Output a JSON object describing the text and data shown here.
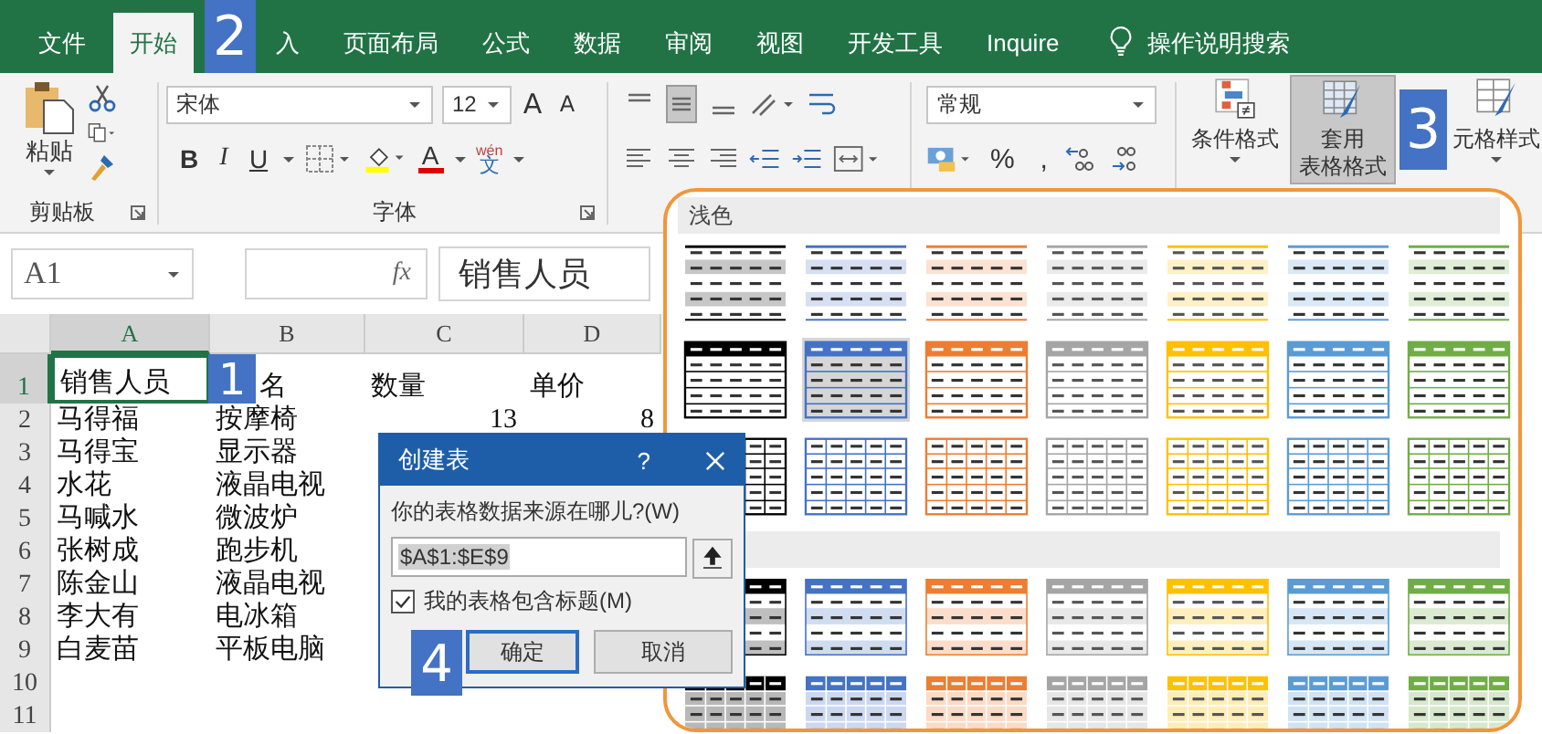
{
  "tabs": [
    {
      "label": "文件",
      "selected": false
    },
    {
      "label": "开始",
      "selected": true
    },
    {
      "label": "入",
      "selected": false,
      "badge": "2"
    },
    {
      "label": "页面布局",
      "selected": false
    },
    {
      "label": "公式",
      "selected": false
    },
    {
      "label": "数据",
      "selected": false
    },
    {
      "label": "审阅",
      "selected": false
    },
    {
      "label": "视图",
      "selected": false
    },
    {
      "label": "开发工具",
      "selected": false
    },
    {
      "label": "Inquire",
      "selected": false
    }
  ],
  "tell_me": "操作说明搜索",
  "ribbon": {
    "clipboard": {
      "paste": "粘贴",
      "label": "剪贴板"
    },
    "font": {
      "name": "宋体",
      "size": "12",
      "grow": "A",
      "shrink": "A",
      "bold": "B",
      "italic": "I",
      "underline": "U",
      "color_letter": "A",
      "phonetic_top": "wén",
      "phonetic": "文",
      "label": "字体"
    },
    "number": {
      "format": "常规",
      "percent": "%",
      "comma": ","
    },
    "styles": {
      "conditional": "条件格式",
      "table_line1": "套用",
      "table_line2": "表格格式",
      "table_selected": true,
      "badge": "3",
      "cell": "元格样式"
    }
  },
  "formula_bar": {
    "name_box": "A1",
    "fx": "fx",
    "content": "销售人员"
  },
  "sheet": {
    "columns": [
      "A",
      "B",
      "C",
      "D"
    ],
    "rows": [
      {
        "header": "1",
        "cells": [
          {
            "text": "销售人员",
            "selected": true
          },
          {
            "text": "名",
            "selected": false,
            "badge": "1"
          },
          {
            "text": "数量",
            "selected": false
          },
          {
            "text": "单价",
            "selected": false
          }
        ]
      },
      {
        "header": "2",
        "cells": [
          {
            "text": "马得福",
            "selected": false
          },
          {
            "text": "按摩椅",
            "selected": false
          },
          {
            "text": "13",
            "selected": false
          },
          {
            "text": "8",
            "selected": false
          }
        ]
      },
      {
        "header": "3",
        "cells": [
          {
            "text": "马得宝",
            "selected": false
          },
          {
            "text": "显示器",
            "selected": false
          }
        ]
      },
      {
        "header": "4",
        "cells": [
          {
            "text": "水花",
            "selected": false
          },
          {
            "text": "液晶电视",
            "selected": false
          }
        ]
      },
      {
        "header": "5",
        "cells": [
          {
            "text": "马喊水",
            "selected": false
          },
          {
            "text": "微波炉",
            "selected": false
          }
        ]
      },
      {
        "header": "6",
        "cells": [
          {
            "text": "张树成",
            "selected": false
          },
          {
            "text": "跑步机",
            "selected": false
          }
        ]
      },
      {
        "header": "7",
        "cells": [
          {
            "text": "陈金山",
            "selected": false
          },
          {
            "text": "液晶电视",
            "selected": false
          }
        ]
      },
      {
        "header": "8",
        "cells": [
          {
            "text": "李大有",
            "selected": false
          },
          {
            "text": "电冰箱",
            "selected": false
          }
        ]
      },
      {
        "header": "9",
        "cells": [
          {
            "text": "白麦苗",
            "selected": false
          },
          {
            "text": "平板电脑",
            "selected": false
          }
        ]
      },
      {
        "header": "10",
        "cells": []
      },
      {
        "header": "11",
        "cells": []
      }
    ]
  },
  "gallery": {
    "sections": [
      {
        "label": "浅色",
        "rows": [
          {
            "kind": "plain",
            "styles": [
              {
                "color": "#000000",
                "selected": false
              },
              {
                "color": "#4472c4",
                "selected": false
              },
              {
                "color": "#ed7d31",
                "selected": false
              },
              {
                "color": "#a5a5a5",
                "selected": false
              },
              {
                "color": "#ffc000",
                "selected": false
              },
              {
                "color": "#5b9bd5",
                "selected": false
              },
              {
                "color": "#70ad47",
                "selected": false
              }
            ]
          },
          {
            "kind": "header",
            "styles": [
              {
                "color": "#000000",
                "selected": false
              },
              {
                "color": "#4472c4",
                "selected": true
              },
              {
                "color": "#ed7d31",
                "selected": false
              },
              {
                "color": "#a5a5a5",
                "selected": false
              },
              {
                "color": "#ffc000",
                "selected": false
              },
              {
                "color": "#5b9bd5",
                "selected": false
              },
              {
                "color": "#70ad47",
                "selected": false
              }
            ]
          },
          {
            "kind": "grid",
            "styles": [
              {
                "color": "#000000",
                "selected": false
              },
              {
                "color": "#4472c4",
                "selected": false
              },
              {
                "color": "#ed7d31",
                "selected": false
              },
              {
                "color": "#a5a5a5",
                "selected": false
              },
              {
                "color": "#ffc000",
                "selected": false
              },
              {
                "color": "#5b9bd5",
                "selected": false
              },
              {
                "color": "#70ad47",
                "selected": false
              }
            ]
          }
        ]
      },
      {
        "rows": [
          {
            "kind": "banded",
            "styles": [
              {
                "color": "#000000",
                "selected": false
              },
              {
                "color": "#4472c4",
                "selected": false
              },
              {
                "color": "#ed7d31",
                "selected": false
              },
              {
                "color": "#a5a5a5",
                "selected": false
              },
              {
                "color": "#ffc000",
                "selected": false
              },
              {
                "color": "#5b9bd5",
                "selected": false
              },
              {
                "color": "#70ad47",
                "selected": false
              }
            ]
          },
          {
            "kind": "filled",
            "styles": [
              {
                "color": "#000000",
                "selected": false
              },
              {
                "color": "#4472c4",
                "selected": false
              },
              {
                "color": "#ed7d31",
                "selected": false
              },
              {
                "color": "#a5a5a5",
                "selected": false
              },
              {
                "color": "#ffc000",
                "selected": false
              },
              {
                "color": "#5b9bd5",
                "selected": false
              },
              {
                "color": "#70ad47",
                "selected": false
              }
            ]
          }
        ]
      }
    ]
  },
  "dialog": {
    "title": "创建表",
    "help": "?",
    "prompt": "你的表格数据来源在哪儿?(W)",
    "range": "$A$1:$E$9",
    "headers_label": "我的表格包含标题(M)",
    "headers_checked": true,
    "buttons": [
      {
        "label": "确定",
        "default": true,
        "badge": "4"
      },
      {
        "label": "取消",
        "default": false
      }
    ]
  }
}
